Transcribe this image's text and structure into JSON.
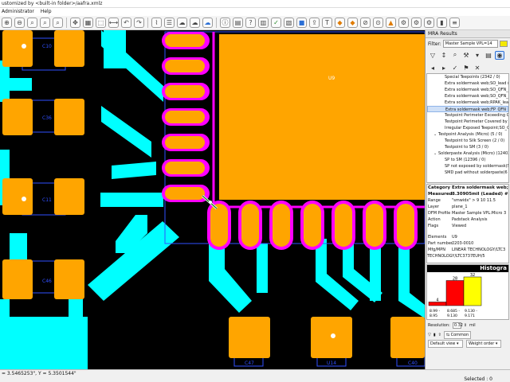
{
  "window": {
    "title": "ustomized by <built-in folder>/aafra.xmlz"
  },
  "menu": [
    "Administrator",
    "Help"
  ],
  "toolbar": {
    "icons": [
      "zoom-in-icon",
      "zoom-out-icon",
      "zoom-fit-icon",
      "zoom-window-icon",
      "zoom-prev-icon",
      "pan-icon",
      "layers-icon",
      "select-icon",
      "measure-icon",
      "undo-icon",
      "redo-icon",
      "net-icon",
      "highlight-icon",
      "cloud-icon",
      "cloud2-icon",
      "cloud3-icon",
      "info-icon",
      "report-icon",
      "query-icon",
      "grid-icon",
      "check-icon",
      "dfm-icon",
      "dfm2-icon",
      "export-icon",
      "text-icon",
      "drc-icon",
      "sm-icon",
      "sp-icon",
      "tp-icon",
      "fabrication-icon",
      "assembly-icon",
      "options-icon",
      "settings-icon",
      "chart-icon",
      "list-icon",
      "help-icon"
    ]
  },
  "canvas": {
    "labels": {
      "c10": "C10",
      "c36": "C36",
      "c11": "C11",
      "c46": "C46",
      "c47": "C47",
      "u14": "U14",
      "c40": "C40",
      "u9": "U9"
    },
    "colors": {
      "background": "#000000",
      "trace": "#00ffff",
      "pad": "#ffa500",
      "soldermask": "#ff00ff",
      "outline": "#3050ff"
    }
  },
  "panel": {
    "title": "MRA Results",
    "filter_label": "Filter:",
    "filter_value": "Master Sample VPL=14",
    "tree": [
      {
        "label": "Special Teepoints (2342 / 0)",
        "indent": 2,
        "arrow": ""
      },
      {
        "label": "Extra soldermask web;SO_lead (",
        "indent": 2,
        "arrow": ""
      },
      {
        "label": "Extra soldermask web;SO_QFN_l",
        "indent": 2,
        "arrow": ""
      },
      {
        "label": "Extra soldermask web;SO_QFN_le",
        "indent": 2,
        "arrow": ""
      },
      {
        "label": "Extra soldermask web;RPAK_lead",
        "indent": 2,
        "arrow": ""
      },
      {
        "label": "Extra soldermask web;FP_QFN_le",
        "indent": 2,
        "arrow": "",
        "selected": true
      },
      {
        "label": "Testpoint Perimeter Exceeding Co",
        "indent": 2,
        "arrow": ""
      },
      {
        "label": "Testpoint Perimeter Covered by C",
        "indent": 2,
        "arrow": ""
      },
      {
        "label": "Irregular Exposed Teepoint;SO_Q",
        "indent": 2,
        "arrow": ""
      },
      {
        "label": "Testpoint Analysis (Micro) (5 / 0)",
        "indent": 1,
        "arrow": "v"
      },
      {
        "label": "Testpoint to Silk Screen (2 / 0)",
        "indent": 2,
        "arrow": ""
      },
      {
        "label": "Testpoint to SM (3 / 0)",
        "indent": 2,
        "arrow": ""
      },
      {
        "label": "Solderpaste Analysis (Micro) (12402",
        "indent": 1,
        "arrow": "v"
      },
      {
        "label": "SP to SM (12396 / 0)",
        "indent": 2,
        "arrow": ""
      },
      {
        "label": "SP not exposed by soldermask(S",
        "indent": 2,
        "arrow": ""
      },
      {
        "label": "SMD pad without solderpaste(6 / 0",
        "indent": 2,
        "arrow": ""
      }
    ],
    "props": {
      "category_key": "Category",
      "category_val": "Extra soldermask web;F",
      "measured_key": "Measured",
      "measured_val": "8.30905mil (Leaded) #",
      "range_key": "Range",
      "range_val": "\"smwidx\" > 9 10 11.5",
      "layer_key": "Layer",
      "layer_val": "plane_1",
      "dfm_key": "DFM Profile",
      "dfm_val": "Master Sample VPL:Micro 3",
      "action_key": "Action",
      "action_val": "Padstack Analysis",
      "flags_key": "Flags",
      "flags_val": "Viewed",
      "elements_key": "Elements",
      "elements_val": "U9",
      "part_key": "Part number",
      "part_val": "2203-0010",
      "mfg_key": "Mfg/MPN",
      "mfg_val": "LINEAR TECHNOLOGY/LTC3",
      "tech_val": "TECHNOLOGY/LTC3737EUH/5"
    },
    "histogram": {
      "title": "Histogra",
      "bars": [
        {
          "value": 4,
          "color": "#ff0000"
        },
        {
          "value": 28,
          "color": "#ff0000"
        },
        {
          "value": 32,
          "color": "#ffff00"
        }
      ],
      "tick_labels": [
        "8.99 -",
        "8.685 -",
        "9.130 -"
      ],
      "sub_labels": [
        "8.95",
        "9.130",
        "9.171"
      ]
    },
    "resolution_label": "Resolution:",
    "resolution_value": "0.32",
    "resolution_unit": "mil",
    "common_label": "Common",
    "default_view": "Default view",
    "weight_order": "Weight order"
  },
  "status": {
    "coords": "= 3.5465253\", Y = 5.3501544\"",
    "selected": "Selected : 0"
  }
}
